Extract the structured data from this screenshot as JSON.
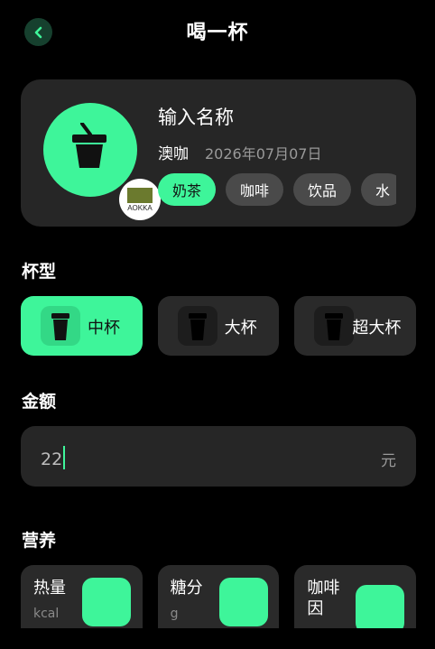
{
  "header": {
    "title": "喝一杯"
  },
  "drink": {
    "name": "输入名称",
    "brand": "澳咖",
    "date": "2026年07月07日",
    "logo_text": "AOKKA",
    "tags": [
      {
        "label": "奶茶",
        "active": true
      },
      {
        "label": "咖啡",
        "active": false
      },
      {
        "label": "饮品",
        "active": false
      },
      {
        "label": "水",
        "active": false
      }
    ]
  },
  "cup_section": {
    "title": "杯型",
    "options": [
      {
        "label": "中杯",
        "active": true
      },
      {
        "label": "大杯",
        "active": false
      },
      {
        "label": "超大杯",
        "active": false
      }
    ]
  },
  "amount_section": {
    "title": "金额",
    "value": "22",
    "unit": "元"
  },
  "nutrition_section": {
    "title": "营养",
    "items": [
      {
        "label": "热量",
        "unit": "kcal"
      },
      {
        "label": "糖分",
        "unit": "g"
      },
      {
        "label": "咖啡因",
        "unit": ""
      }
    ]
  },
  "colors": {
    "accent": "#3ef59a",
    "background": "#000000",
    "card": "#262626",
    "chip": "#4a4a4a"
  },
  "icons": {
    "back": "chevron-left-icon",
    "cup": "cup-icon"
  }
}
